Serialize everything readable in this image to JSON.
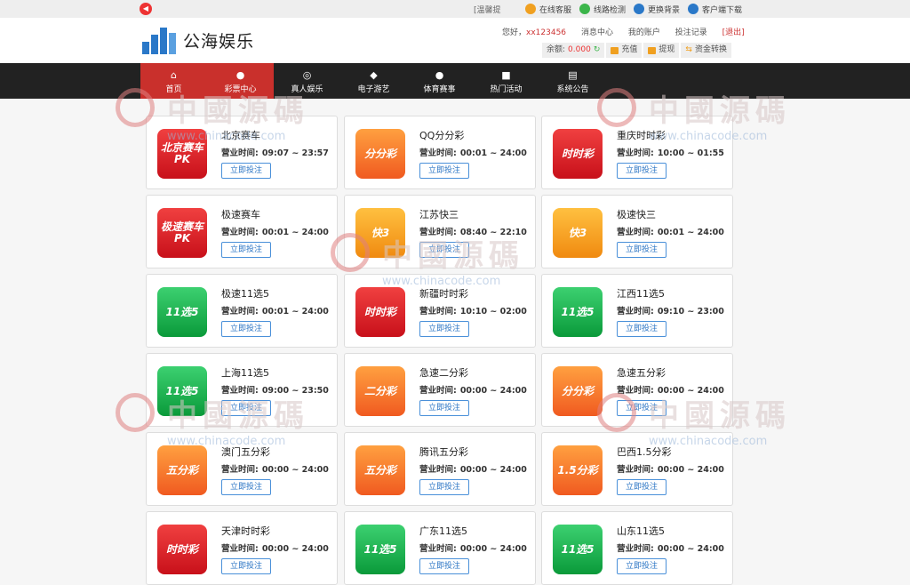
{
  "topbar": {
    "marquee": "[温馨提",
    "links": [
      {
        "label": "在线客服",
        "color": "#f0a020",
        "icon": "chat-icon"
      },
      {
        "label": "线路检测",
        "color": "#3bb54a",
        "icon": "route-icon"
      },
      {
        "label": "更换背景",
        "color": "#2a78c8",
        "icon": "background-icon"
      },
      {
        "label": "客户端下载",
        "color": "#2a78c8",
        "icon": "download-icon"
      }
    ]
  },
  "header": {
    "site_name": "公海娱乐",
    "greeting": "您好，",
    "username": "xx123456",
    "links": [
      "消息中心",
      "我的账户",
      "投注记录"
    ],
    "logout": "[退出]",
    "balance_label": "余额:",
    "balance_value": "0.000",
    "actions": [
      "充值",
      "提现",
      "资金转换"
    ]
  },
  "nav": [
    {
      "label": "首页",
      "icon": "home-icon",
      "glyph": "⌂"
    },
    {
      "label": "彩票中心",
      "icon": "lottery-icon",
      "glyph": "●"
    },
    {
      "label": "真人娱乐",
      "icon": "live-casino-icon",
      "glyph": "◎"
    },
    {
      "label": "电子游艺",
      "icon": "gamepad-icon",
      "glyph": "◆"
    },
    {
      "label": "体育赛事",
      "icon": "basketball-icon",
      "glyph": "●"
    },
    {
      "label": "热门活动",
      "icon": "gift-icon",
      "glyph": "■"
    },
    {
      "label": "系统公告",
      "icon": "notice-icon",
      "glyph": "▤"
    }
  ],
  "bet_label": "立即投注",
  "hours_label": "营业时间:",
  "games": [
    {
      "name": "北京赛车",
      "hours": "09:07 ~ 23:57",
      "logo": "北京赛车PK",
      "style": "red"
    },
    {
      "name": "QQ分分彩",
      "hours": "00:01 ~ 24:00",
      "logo": "分分彩",
      "style": "orange"
    },
    {
      "name": "重庆时时彩",
      "hours": "10:00 ~ 01:55",
      "logo": "时时彩",
      "style": "red"
    },
    {
      "name": "极速赛车",
      "hours": "00:01 ~ 24:00",
      "logo": "极速赛车PK",
      "style": "red"
    },
    {
      "name": "江苏快三",
      "hours": "08:40 ~ 22:10",
      "logo": "快3",
      "style": "amber"
    },
    {
      "name": "极速快三",
      "hours": "00:01 ~ 24:00",
      "logo": "快3",
      "style": "amber"
    },
    {
      "name": "极速11选5",
      "hours": "00:01 ~ 24:00",
      "logo": "11选5",
      "style": "green"
    },
    {
      "name": "新疆时时彩",
      "hours": "10:10 ~ 02:00",
      "logo": "时时彩",
      "style": "red"
    },
    {
      "name": "江西11选5",
      "hours": "09:10 ~ 23:00",
      "logo": "11选5",
      "style": "green"
    },
    {
      "name": "上海11选5",
      "hours": "09:00 ~ 23:50",
      "logo": "11选5",
      "style": "green"
    },
    {
      "name": "急速二分彩",
      "hours": "00:00 ~ 24:00",
      "logo": "二分彩",
      "style": "orange"
    },
    {
      "name": "急速五分彩",
      "hours": "00:00 ~ 24:00",
      "logo": "分分彩",
      "style": "orange"
    },
    {
      "name": "澳门五分彩",
      "hours": "00:00 ~ 24:00",
      "logo": "五分彩",
      "style": "orange"
    },
    {
      "name": "腾讯五分彩",
      "hours": "00:00 ~ 24:00",
      "logo": "五分彩",
      "style": "orange"
    },
    {
      "name": "巴西1.5分彩",
      "hours": "00:00 ~ 24:00",
      "logo": "1.5分彩",
      "style": "orange"
    },
    {
      "name": "天津时时彩",
      "hours": "00:00 ~ 24:00",
      "logo": "时时彩",
      "style": "red"
    },
    {
      "name": "广东11选5",
      "hours": "00:00 ~ 24:00",
      "logo": "11选5",
      "style": "green"
    },
    {
      "name": "山东11选5",
      "hours": "00:00 ~ 24:00",
      "logo": "11选5",
      "style": "green"
    }
  ],
  "watermark": {
    "title": "中國源碼",
    "url": "www.chinacode.com"
  }
}
